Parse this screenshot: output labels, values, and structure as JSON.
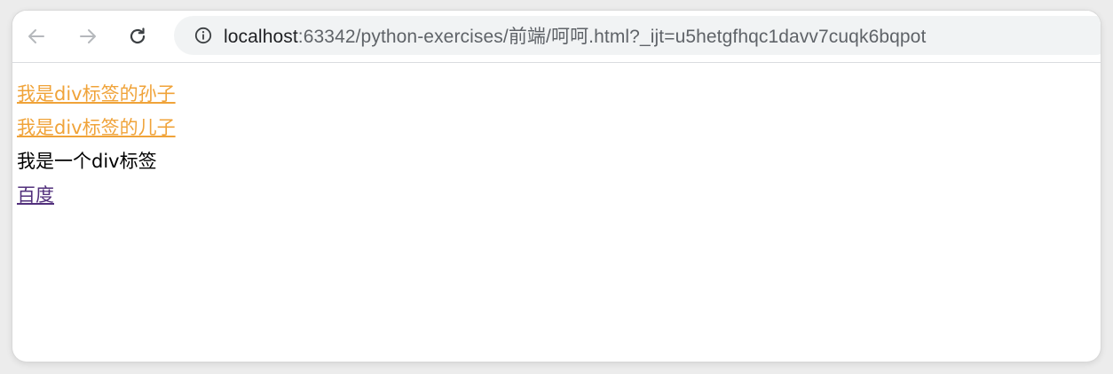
{
  "browser": {
    "url_host": "localhost",
    "url_rest": ":63342/python-exercises/前端/呵呵.html?_ijt=u5hetgfhqc1davv7cuqk6bqpot",
    "back_icon": "back-arrow-icon",
    "forward_icon": "forward-arrow-icon",
    "reload_icon": "reload-icon",
    "info_icon": "info-icon"
  },
  "page": {
    "grandson_link": "我是div标签的孙子",
    "son_link": "我是div标签的儿子",
    "div_text": "我是一个div标签",
    "baidu_link": "百度"
  },
  "colors": {
    "orange_link": "#f0a339",
    "visited_link": "#52307c",
    "text": "#000000"
  }
}
